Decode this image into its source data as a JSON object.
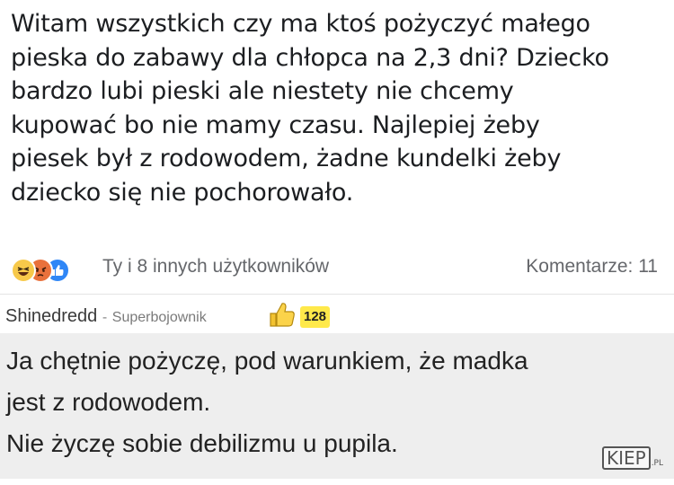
{
  "post": {
    "lines": [
      "Witam wszystkich czy ma ktoś pożyczyć małego",
      "pieska do zabawy dla chłopca na 2,3 dni? Dziecko",
      "bardzo lubi pieski ale niestety nie chcemy",
      "kupować bo nie mamy czasu. Najlepiej żeby",
      "piesek był z rodowodem, żadne kundelki żeby",
      "dziecko się nie pochorowało."
    ],
    "reactions": [
      "haha-icon",
      "angry-icon",
      "like-icon"
    ],
    "reactors_text": "Ty i 8 innych użytkowników",
    "comments_text": "Komentarze: 11"
  },
  "comment": {
    "author": "Shinedredd",
    "separator": "-",
    "rank": "Superbojownik",
    "score": "128",
    "lines": [
      "Ja chętnie pożyczę, pod warunkiem, że madka",
      "jest z rodowodem.",
      "Nie życzę sobie debilizmu u pupila."
    ]
  },
  "watermark": {
    "main": "KIEP",
    "suffix": ".PL"
  },
  "colors": {
    "haha": "#f7c94a",
    "angry": "#e9713c",
    "like": "#2f86f6",
    "score_badge": "#ffe94a",
    "comment_bg": "#eeeeee"
  }
}
